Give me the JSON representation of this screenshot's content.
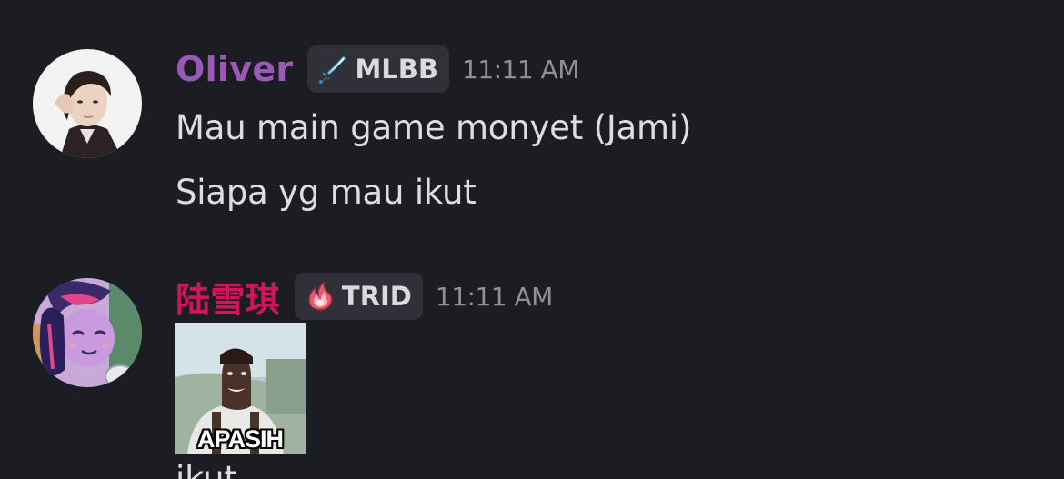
{
  "messages": [
    {
      "username": "Oliver",
      "tag": {
        "label": "MLBB",
        "icon": "sword-icon"
      },
      "timestamp": "11:11 AM",
      "lines": [
        "Mau main game monyet (Jami)",
        "Siapa yg mau ikut"
      ]
    },
    {
      "username": "陆雪琪",
      "tag": {
        "label": "TRID",
        "icon": "fire-icon"
      },
      "timestamp": "11:11 AM",
      "sticker": {
        "caption": "APASIH"
      },
      "partial_line": "ikut"
    }
  ],
  "colors": {
    "background": "#1c1d23",
    "username_1": "#9b59b6",
    "username_2": "#d4145a",
    "tag_background": "#2f3038",
    "timestamp": "#8e9099",
    "message_text": "#dcdde2"
  }
}
